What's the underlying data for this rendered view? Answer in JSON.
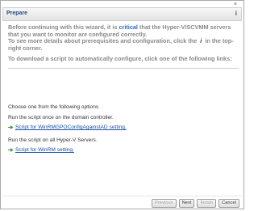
{
  "window": {
    "title": "Prepare",
    "close_glyph": "×",
    "info_glyph": "i"
  },
  "intro": {
    "line1_pre": "Before continuing with this wizard, it is",
    "line1_emph": "critical",
    "line1_post": "that the Hyper-V/SCVMM servers that you want to monitor are configured correctly.",
    "line2_pre": "To see more details about prerequisites and configuration, click the",
    "line2_icon": "i",
    "line2_post": "in the top-right corner.",
    "line3": "To download a script to automatically configure, click one of the following links:"
  },
  "options": {
    "heading": "Choose one from the following options",
    "domain_controller_text": "Run the script once on the domain controller.",
    "domain_controller_link": "Script for WinRMGPOConfigAgainstAD setting.",
    "hyperv_text": "Run the script on all Hyper-V Servers.",
    "hyperv_link": "Script for WinRM setting."
  },
  "buttons": {
    "previous": "Previous",
    "next": "Next",
    "finish": "Finish",
    "cancel": "Cancel"
  },
  "colors": {
    "title": "#1f4e8c",
    "critical": "#2b6fc2",
    "link": "#1a4fa3",
    "download_icon": "#3a9a3a"
  },
  "icons": {
    "download": "download-arrow-icon",
    "info": "info-icon",
    "close": "close-icon"
  }
}
